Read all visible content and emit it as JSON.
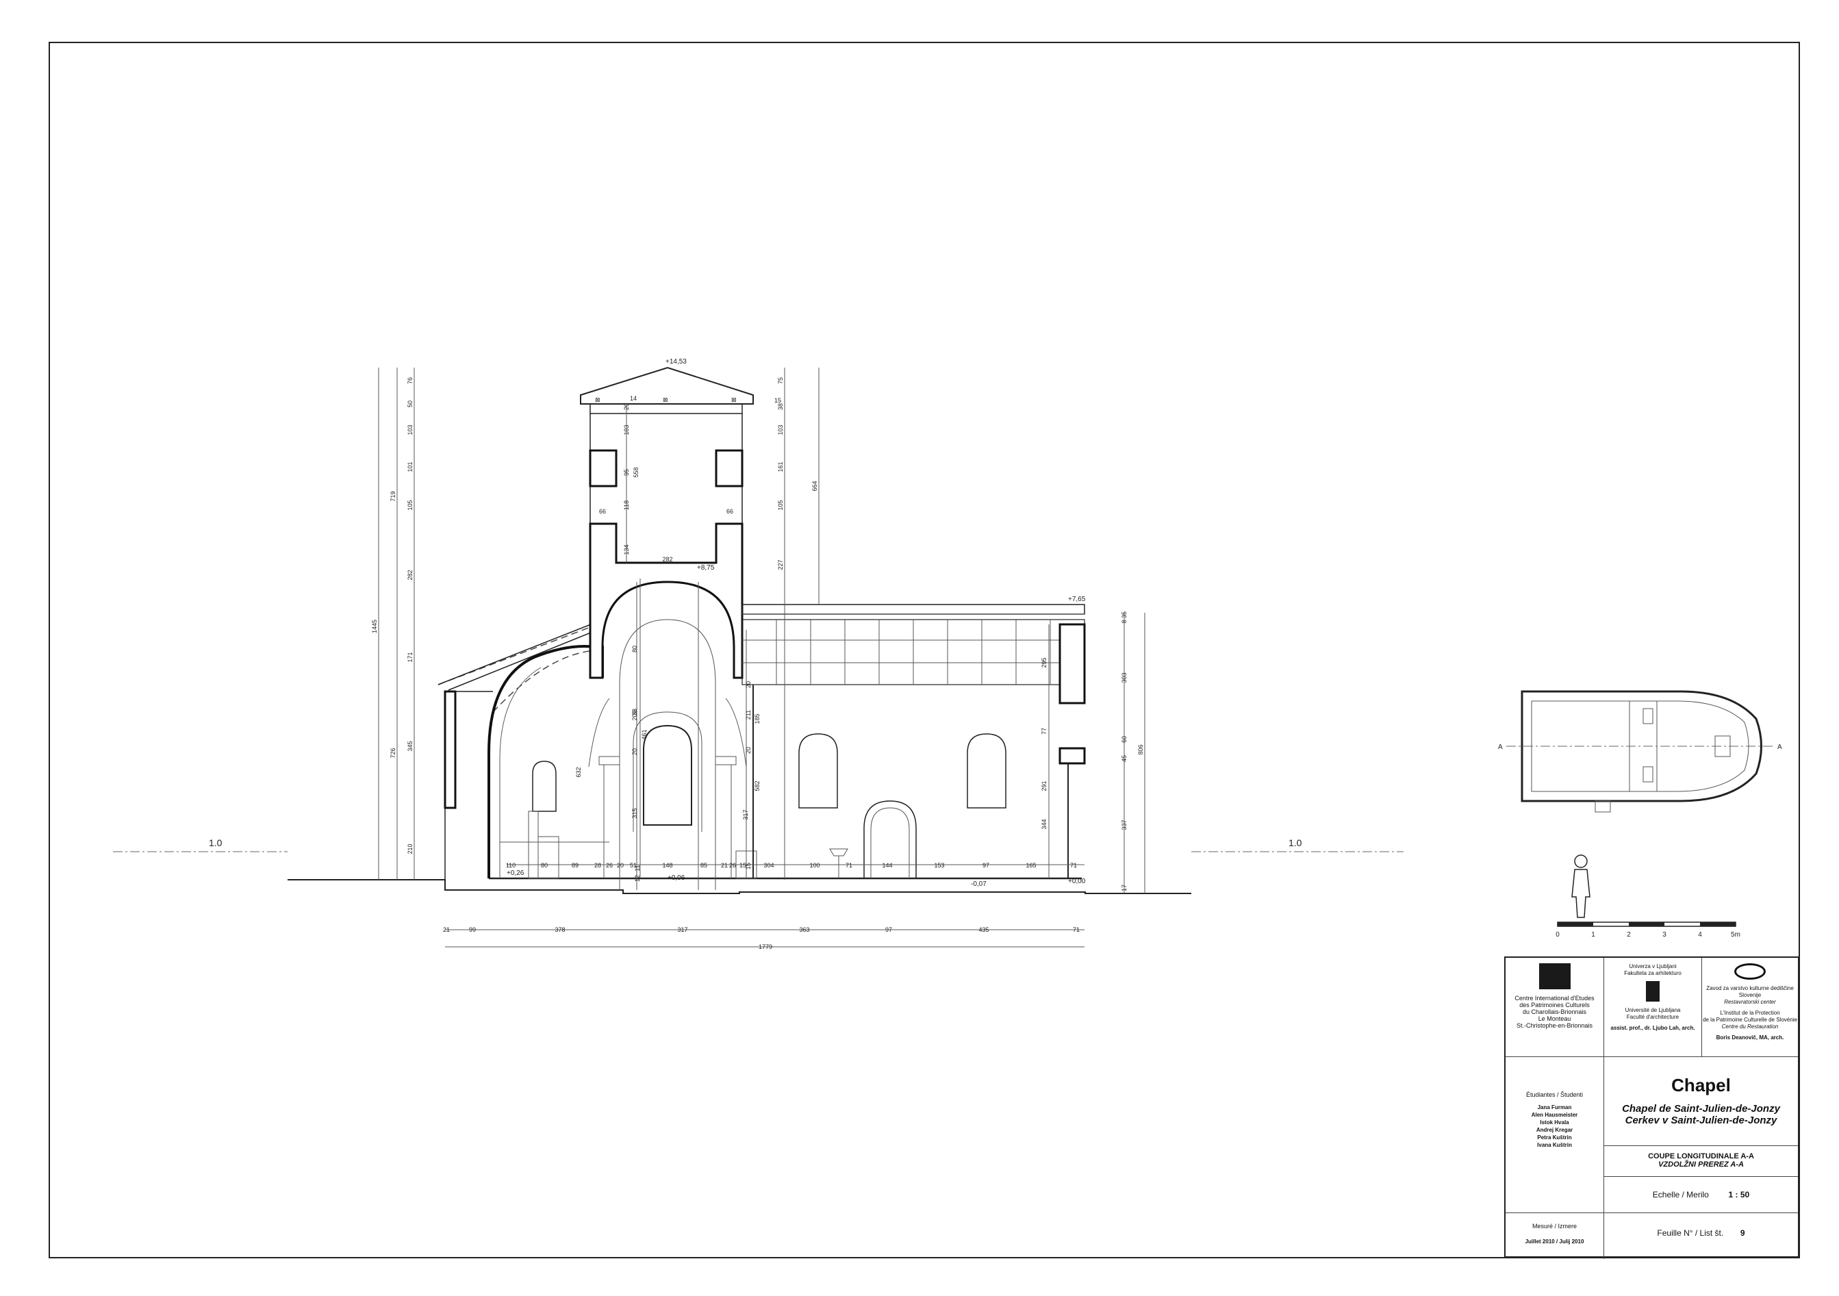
{
  "sheet": {
    "ground_label_left": "1.0",
    "ground_label_right": "1.0"
  },
  "levels": {
    "roof_top": "+14,53",
    "bell_floor": "+8,75",
    "nave_top": "+7,65",
    "floor_front": "+0,26",
    "floor_apse": "+0,06",
    "floor_nave": "-0,07",
    "floor_back": "+0,00"
  },
  "height_dims": {
    "left_total": "1445",
    "left_upper": "719",
    "left_middle": "726",
    "left_chain": [
      "76",
      "50",
      "103",
      "101",
      "105",
      "282",
      "171",
      "345",
      "210"
    ],
    "right_total": "664",
    "right_lower": "227",
    "right_chain": [
      "75",
      "38",
      "103",
      "161",
      "105"
    ],
    "right_small": "15",
    "tower_inner": [
      "20",
      "103",
      "95",
      "118",
      "134",
      "558"
    ],
    "tower_walls": [
      "66",
      "66"
    ],
    "tower_width": "282",
    "tower_top_width": "14",
    "arch_dims": [
      "80",
      "33",
      "209",
      "461",
      "20",
      "632",
      "315",
      "11",
      "12",
      "211",
      "20",
      "20",
      "185",
      "582",
      "317",
      "15"
    ],
    "nave_right": [
      "295",
      "77",
      "291",
      "344"
    ],
    "end_chain": [
      "35",
      "8",
      "303",
      "60",
      "45",
      "337",
      "17"
    ],
    "end_total": "806"
  },
  "floor_dims": [
    "110",
    "80",
    "89",
    "28",
    "26",
    "20",
    "51",
    "148",
    "85",
    "21",
    "26",
    "15",
    "304",
    "100",
    "71",
    "144",
    "153",
    "97",
    "165",
    "71"
  ],
  "bottom_dims": {
    "chain": [
      "21",
      "99",
      "378",
      "317",
      "363",
      "97",
      "435",
      "71"
    ],
    "total": "1779"
  },
  "scale_bar": {
    "ticks": [
      "0",
      "1",
      "2",
      "3",
      "4",
      "5m"
    ]
  },
  "plan": {
    "section_left": "A",
    "section_right": "A"
  },
  "institutions": [
    {
      "logo_text": "Centre International d'Etudes des Patrimoines Culturels",
      "lines": [
        "Centre International d'Etudes",
        "des Patrimoines Culturels",
        "du Charollais-Brionnais",
        "Le Monteau",
        "St.-Christophe-en-Brionnais"
      ],
      "person": ""
    },
    {
      "logo_text": "Univerza v Ljubljani Fakulteta za arhitekturo",
      "lines": [
        "Univerza v Ljubljani",
        "Fakulteta za arhitekturo",
        "",
        "Université de Ljubljana",
        "Faculté d'architecture"
      ],
      "person": "assist. prof., dr. Ljubo Lah, arch."
    },
    {
      "logo_text": "Zavod za varstvo kulturne dediščine Slovenije",
      "lines": [
        "Zavod za varstvo kulturne dediščine Slovenije",
        "Restavratorski center",
        "",
        "L'Institut de la Protection",
        "de la Patrimoine Culturelle de Slovénie",
        "Centre du Restauration"
      ],
      "person": "Boris Deanovič, MA, arch."
    }
  ],
  "students": {
    "heading": "Étudiantes / Študenti",
    "names": [
      "Jana Furman",
      "Alen Hausmeister",
      "Istok Hvala",
      "Andrej Kregar",
      "Petra Kuštrin",
      "Ivana Kuštrin"
    ]
  },
  "title": {
    "main": "Chapel",
    "fr": "Chapel de Saint-Julien-de-Jonzy",
    "sl": "Cerkev v Saint-Julien-de-Jonzy"
  },
  "section": {
    "fr": "COUPE LONGITUDINALE A-A",
    "sl": "VZDOLŽNI PREREZ A-A"
  },
  "scale": {
    "label": "Echelle / Merilo",
    "value": "1 : 50"
  },
  "sheet_no": {
    "label": "Feuille N° / List št.",
    "value": "9"
  },
  "measured": {
    "label": "Mesuré / Izmere",
    "date": "Juillet 2010 / Julij 2010"
  }
}
